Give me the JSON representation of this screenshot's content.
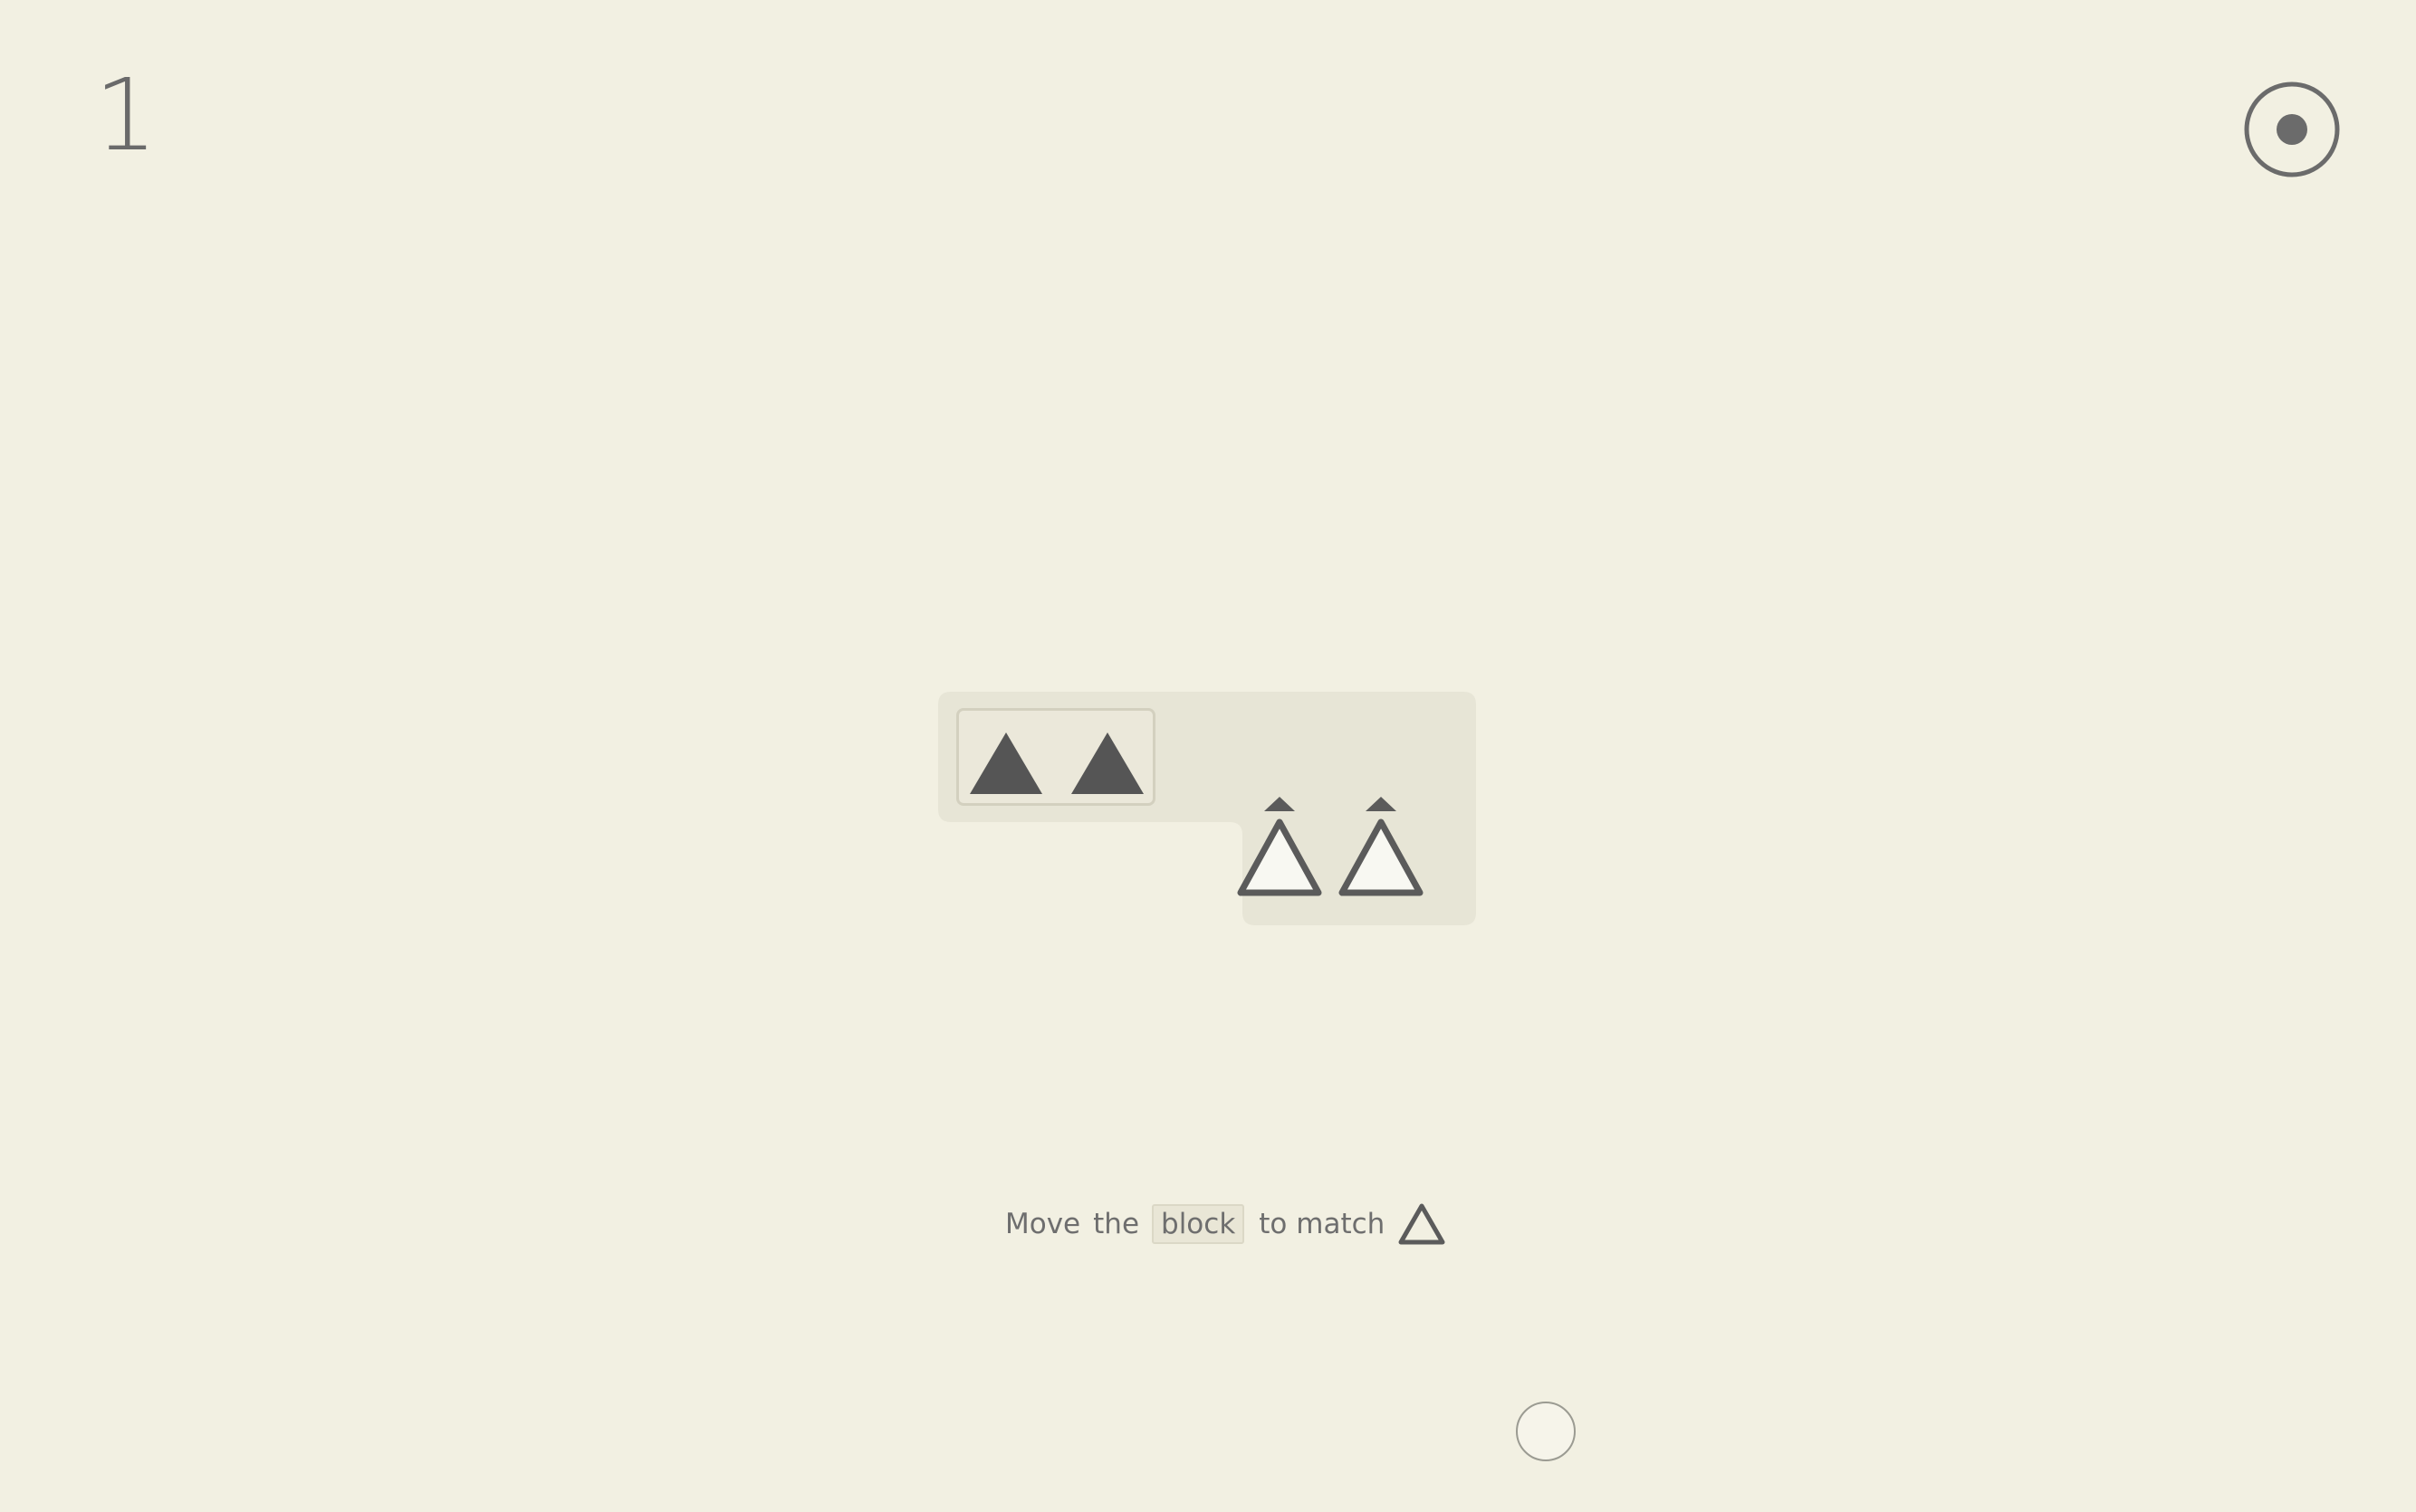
{
  "level": {
    "number": "1"
  },
  "hint": {
    "prefix": "Move",
    "article": "the",
    "keyword": "block",
    "suffix": "to match"
  },
  "icons": {
    "menu": "target-icon",
    "hint_shape": "triangle-outline-icon",
    "block_shape": "filled-triangle-icon",
    "goal_shape": "triangle-outline-icon",
    "goal_marker": "small-up-triangle-icon",
    "action": "circle-button-icon"
  },
  "colors": {
    "background": "#f2f0e2",
    "board": "#e7e5d6",
    "shape_dark": "#555555",
    "goal_fill": "#f8f8f2"
  }
}
